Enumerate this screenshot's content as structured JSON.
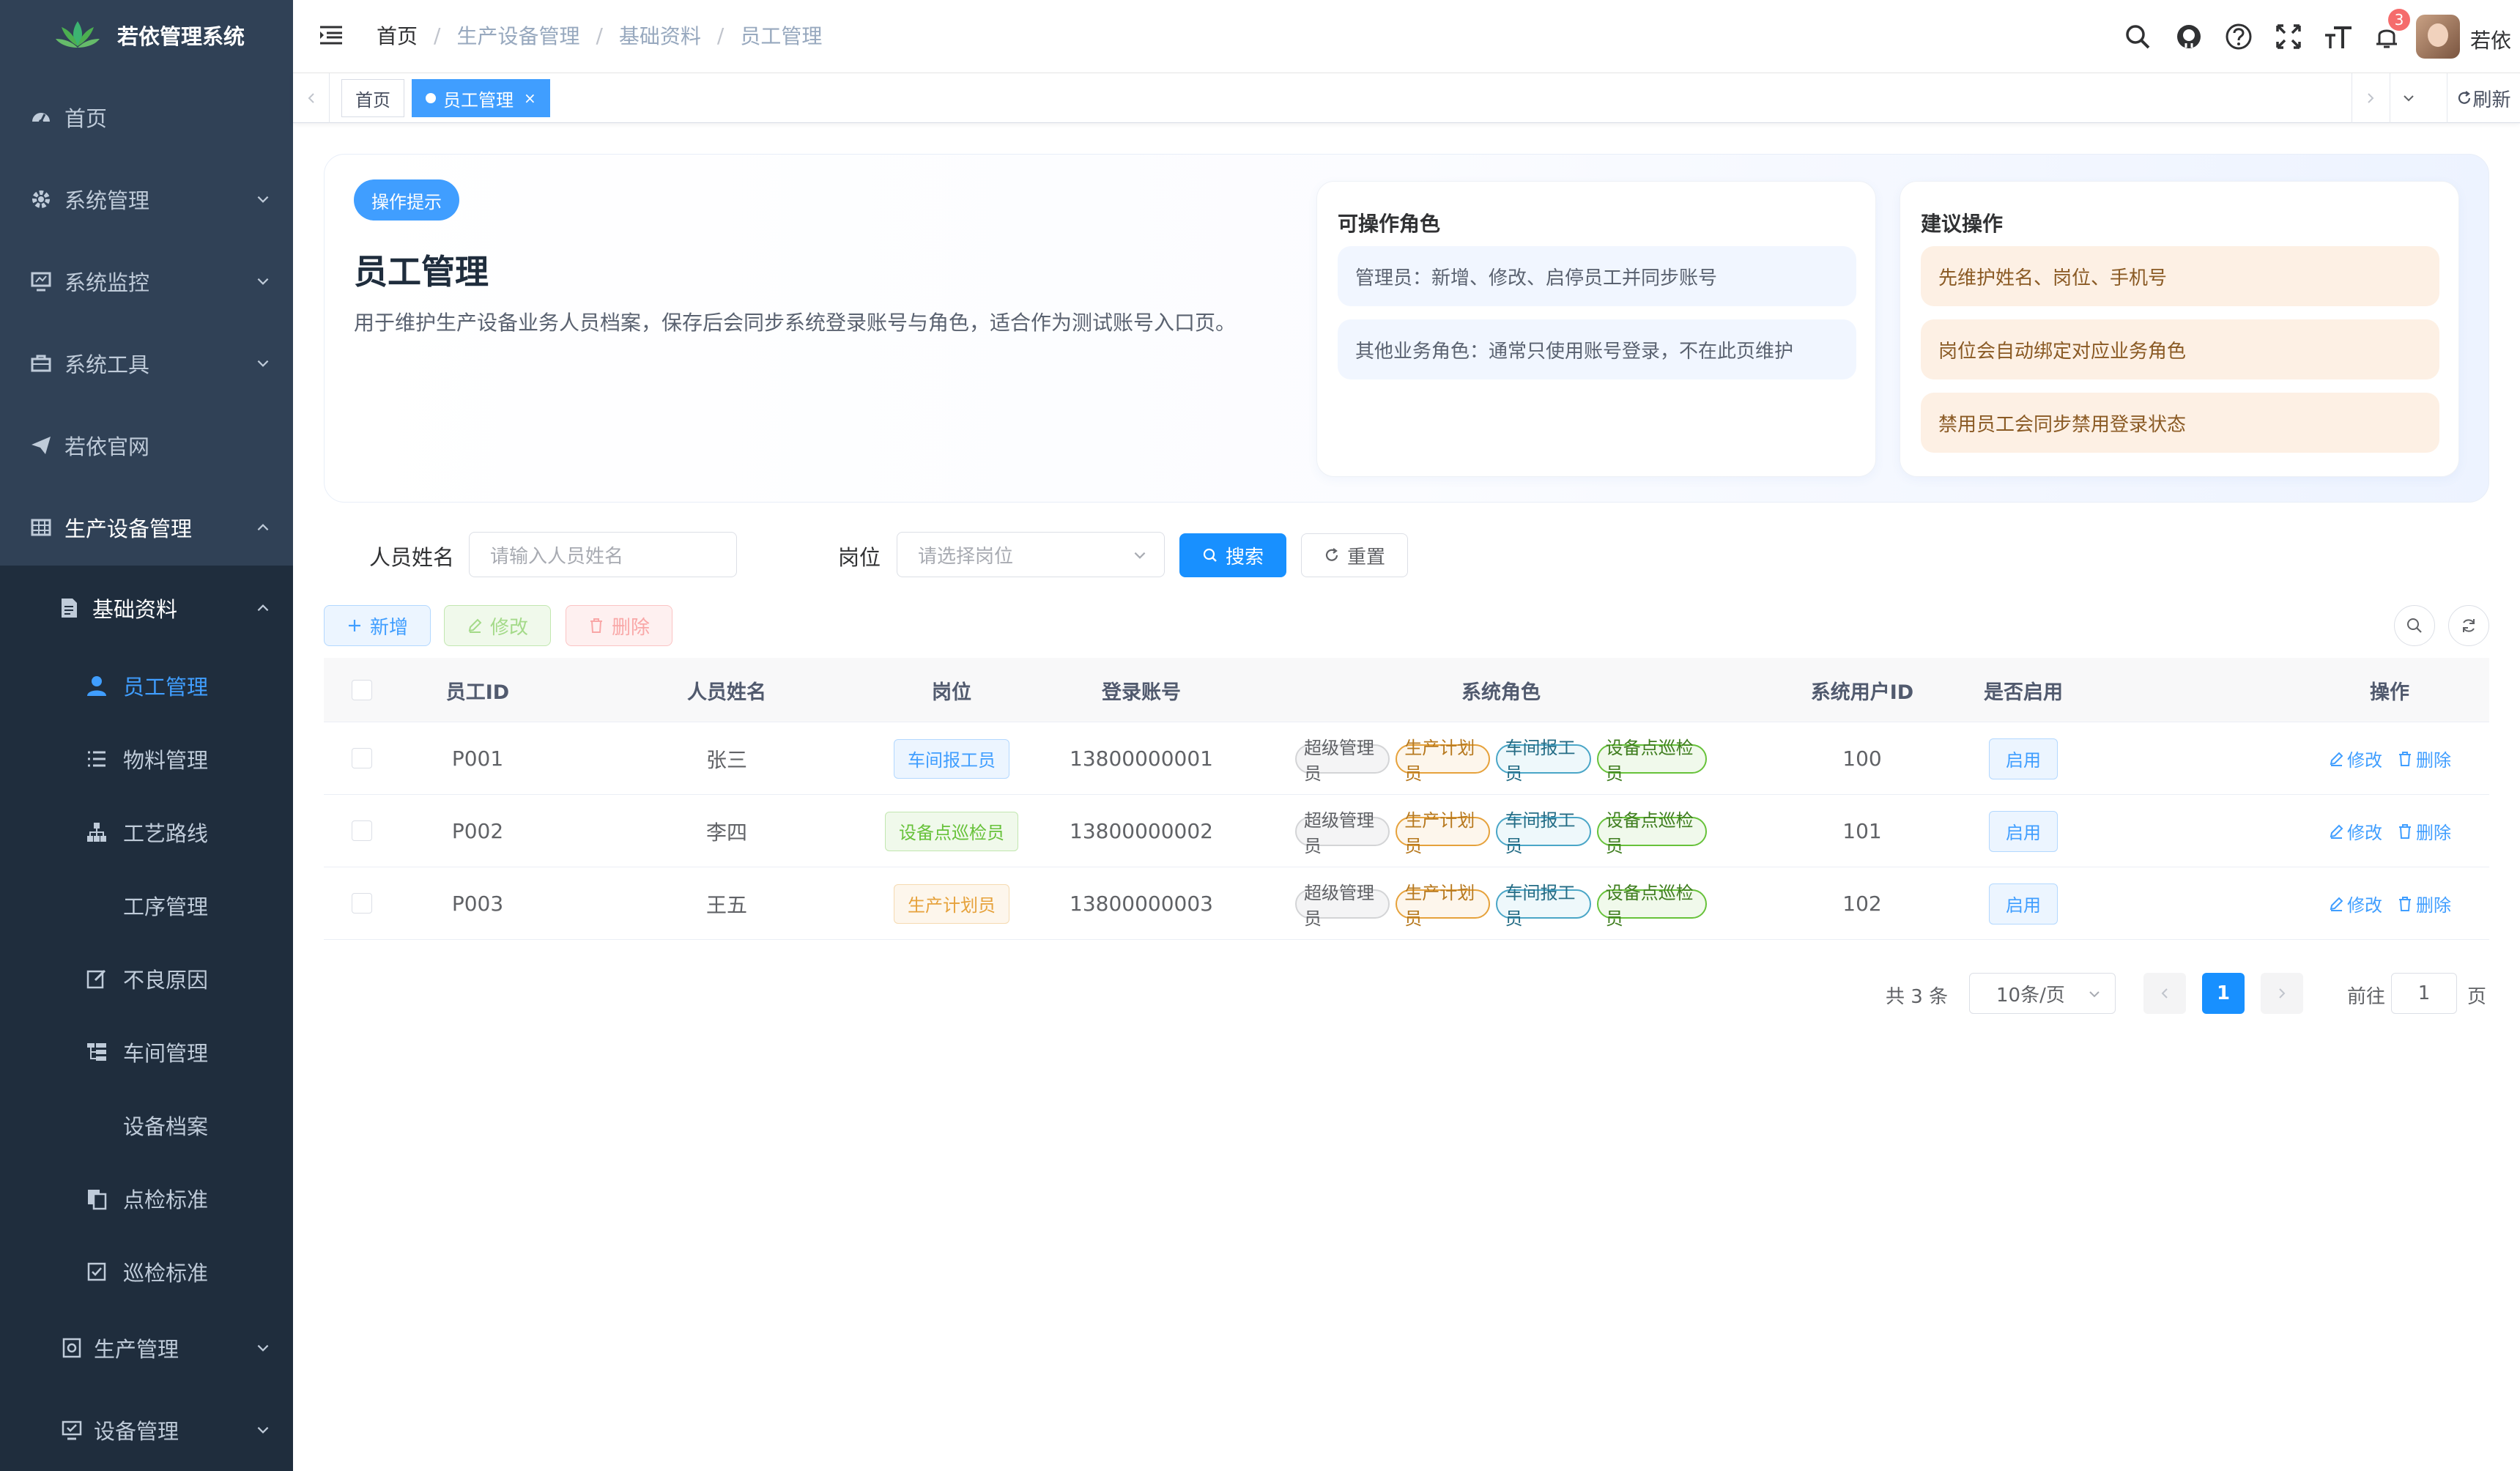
{
  "app": {
    "title": "若依管理系统"
  },
  "sidebar": {
    "items": [
      {
        "label": "首页",
        "icon": "dashboard-icon"
      },
      {
        "label": "系统管理",
        "icon": "gear-icon"
      },
      {
        "label": "系统监控",
        "icon": "monitor-icon"
      },
      {
        "label": "系统工具",
        "icon": "toolbox-icon"
      },
      {
        "label": "若依官网",
        "icon": "paper-plane-icon"
      },
      {
        "label": "生产设备管理",
        "icon": "table-icon"
      }
    ],
    "sub_group": {
      "label": "基础资料",
      "icon": "document-icon"
    },
    "sub_items": [
      {
        "label": "员工管理",
        "icon": "user-icon"
      },
      {
        "label": "物料管理",
        "icon": "list-icon"
      },
      {
        "label": "工艺路线",
        "icon": "tree-icon"
      },
      {
        "label": "工序管理",
        "icon": ""
      },
      {
        "label": "不良原因",
        "icon": "edit-icon"
      },
      {
        "label": "车间管理",
        "icon": "tree-table-icon"
      },
      {
        "label": "设备档案",
        "icon": ""
      },
      {
        "label": "点检标准",
        "icon": "copy-icon"
      },
      {
        "label": "巡检标准",
        "icon": "checkbox-icon"
      }
    ],
    "bottom_items": [
      {
        "label": "生产管理",
        "icon": "production-icon"
      },
      {
        "label": "设备管理",
        "icon": "device-icon"
      }
    ]
  },
  "header": {
    "breadcrumb": [
      "首页",
      "生产设备管理",
      "基础资料",
      "员工管理"
    ],
    "notification_count": "3",
    "user_name": "若依"
  },
  "tags": {
    "items": [
      {
        "label": "首页",
        "active": false
      },
      {
        "label": "员工管理",
        "active": true
      }
    ],
    "close_glyph": "×",
    "refresh_label": "刷新"
  },
  "hint": {
    "tag": "操作提示",
    "title": "员工管理",
    "description": "用于维护生产设备业务人员档案，保存后会同步系统登录账号与角色，适合作为测试账号入口页。",
    "roles_title": "可操作角色",
    "roles": [
      "管理员：新增、修改、启停员工并同步账号",
      "其他业务角色：通常只使用账号登录，不在此页维护"
    ],
    "suggest_title": "建议操作",
    "suggestions": [
      "先维护姓名、岗位、手机号",
      "岗位会自动绑定对应业务角色",
      "禁用员工会同步禁用登录状态"
    ]
  },
  "search": {
    "name_label": "人员姓名",
    "name_placeholder": "请输入人员姓名",
    "post_label": "岗位",
    "post_placeholder": "请选择岗位",
    "search_button": "搜索",
    "reset_button": "重置"
  },
  "toolbar": {
    "add": "新增",
    "edit": "修改",
    "delete": "删除"
  },
  "table": {
    "columns": [
      "员工ID",
      "人员姓名",
      "岗位",
      "登录账号",
      "系统角色",
      "系统用户ID",
      "是否启用",
      "操作"
    ],
    "rows": [
      {
        "id": "P001",
        "name": "张三",
        "post": "车间报工员",
        "post_color": "blue",
        "account": "13800000001",
        "roles": [
          "超级管理员",
          "生产计划员",
          "车间报工员",
          "设备点巡检员"
        ],
        "user_id": "100",
        "status": "启用"
      },
      {
        "id": "P002",
        "name": "李四",
        "post": "设备点巡检员",
        "post_color": "green",
        "account": "13800000002",
        "roles": [
          "超级管理员",
          "生产计划员",
          "车间报工员",
          "设备点巡检员"
        ],
        "user_id": "101",
        "status": "启用"
      },
      {
        "id": "P003",
        "name": "王五",
        "post": "生产计划员",
        "post_color": "yellow",
        "account": "13800000003",
        "roles": [
          "超级管理员",
          "生产计划员",
          "车间报工员",
          "设备点巡检员"
        ],
        "user_id": "102",
        "status": "启用"
      }
    ],
    "edit_label": "修改",
    "delete_label": "删除"
  },
  "pagination": {
    "total": "共 3 条",
    "page_size": "10条/页",
    "current_page": "1",
    "goto_prefix": "前往",
    "goto_value": "1",
    "goto_suffix": "页"
  },
  "colors": {
    "sidebar_bg": "#304156",
    "sidebar_sub_bg": "#1f2d3d",
    "primary": "#409eff",
    "active_tag": "#409eff"
  }
}
